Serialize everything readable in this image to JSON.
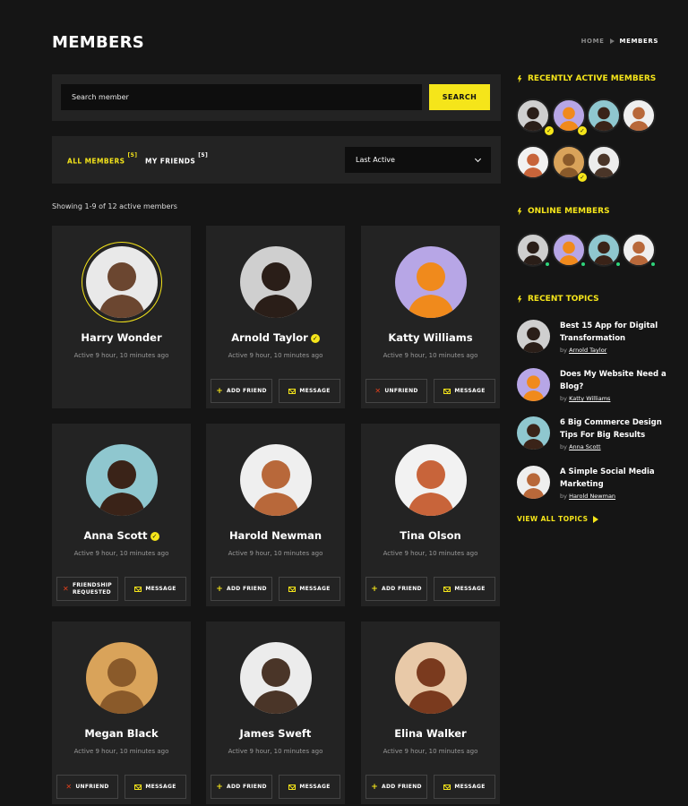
{
  "page": {
    "title": "MEMBERS"
  },
  "breadcrumb": {
    "home": "HOME",
    "current": "MEMBERS"
  },
  "search": {
    "placeholder": "Search member",
    "button": "SEARCH"
  },
  "filters": {
    "tabs": [
      {
        "label": "ALL MEMBERS",
        "count": "5"
      },
      {
        "label": "MY FRIENDS",
        "count": "5"
      }
    ],
    "sort_selected": "Last Active"
  },
  "showing": "Showing 1-9 of 12 active members",
  "members": [
    {
      "name": "Harry Wonder",
      "active": "Active 9 hour, 10 minutes ago",
      "verified": false
    },
    {
      "name": "Arnold Taylor",
      "active": "Active 9 hour, 10 minutes ago",
      "verified": true,
      "btn_left": "ADD FRIEND",
      "btn_right": "MESSAGE"
    },
    {
      "name": "Katty Williams",
      "active": "Active 9 hour, 10 minutes ago",
      "verified": false,
      "btn_left": "UNFRIEND",
      "btn_right": "MESSAGE"
    },
    {
      "name": "Anna Scott",
      "active": "Active 9 hour, 10 minutes ago",
      "verified": true,
      "btn_left_1": "FRIENDSHIP",
      "btn_left_2": "REQUESTED",
      "btn_right": "MESSAGE"
    },
    {
      "name": "Harold Newman",
      "active": "Active 9 hour, 10 minutes ago",
      "verified": false,
      "btn_left": "ADD FRIEND",
      "btn_right": "MESSAGE"
    },
    {
      "name": "Tina Olson",
      "active": "Active 9 hour, 10 minutes ago",
      "verified": false,
      "btn_left": "ADD FRIEND",
      "btn_right": "MESSAGE"
    },
    {
      "name": "Megan Black",
      "active": "Active 9 hour, 10 minutes ago",
      "verified": false,
      "btn_left": "UNFRIEND",
      "btn_right": "MESSAGE"
    },
    {
      "name": "James Sweft",
      "active": "Active 9 hour, 10 minutes ago",
      "verified": false,
      "btn_left": "ADD FRIEND",
      "btn_right": "MESSAGE"
    },
    {
      "name": "Elina Walker",
      "active": "Active 9 hour, 10 minutes ago",
      "verified": false,
      "btn_left": "ADD FRIEND",
      "btn_right": "MESSAGE"
    }
  ],
  "sidebar": {
    "recently_active_title": "RECENTLY ACTIVE MEMBERS",
    "online_title": "ONLINE MEMBERS",
    "topics_title": "RECENT TOPICS",
    "by": "by",
    "topics": [
      {
        "title": "Best 15 App for Digital Transformation",
        "author": "Arnold Taylor"
      },
      {
        "title": "Does My Website Need a Blog?",
        "author": "Katty Williams"
      },
      {
        "title": "6 Big Commerce Design Tips For Big Results",
        "author": "Anna Scott"
      },
      {
        "title": "A Simple Social Media Marketing",
        "author": "Harold Newman"
      }
    ],
    "view_all": "VIEW ALL TOPICS"
  },
  "colors": {
    "accent": "#f5e51a",
    "background": "#151515",
    "card": "#232323",
    "online": "#2ed47a",
    "danger": "#e2401c"
  }
}
